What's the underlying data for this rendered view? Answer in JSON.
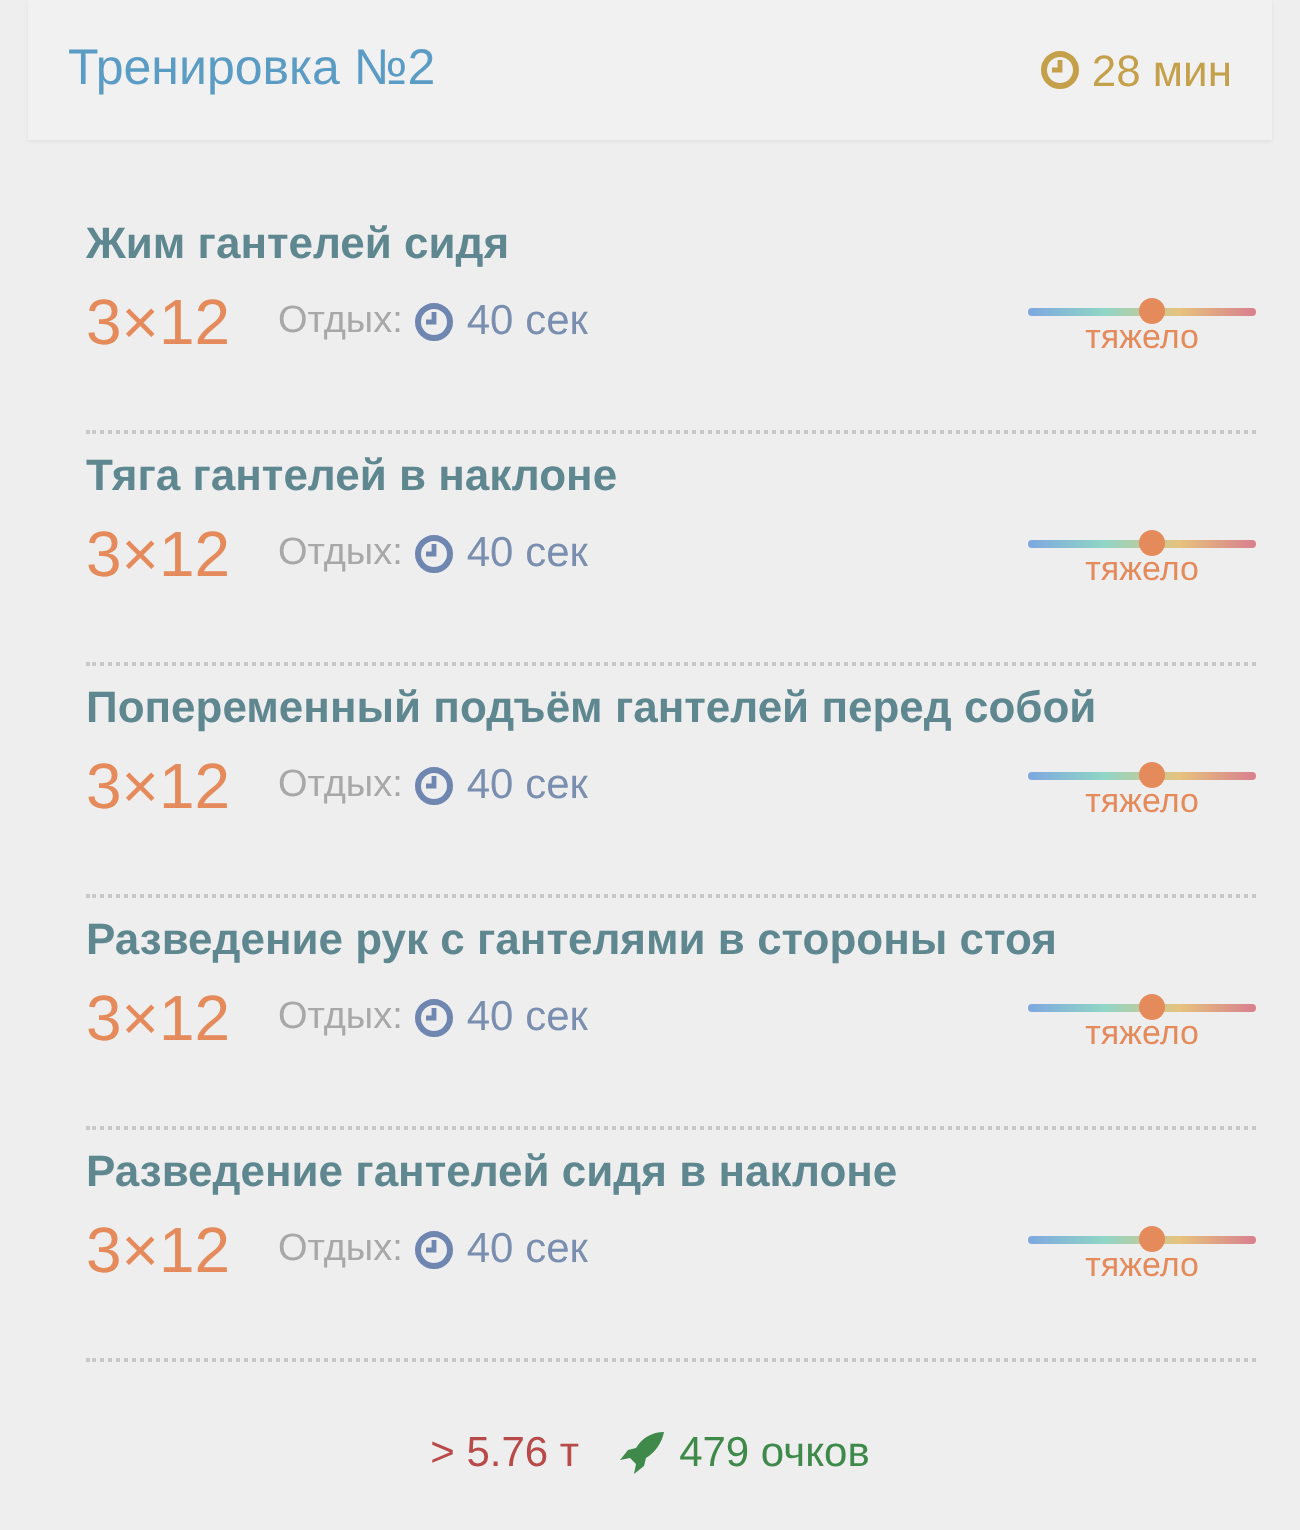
{
  "header": {
    "title": "Тренировка №2",
    "duration": "28 мин"
  },
  "exercises": [
    {
      "name": "Жим гантелей сидя",
      "sets": "3×12",
      "rest_label": "Отдых:",
      "rest": "40 сек",
      "level": 0.54,
      "difficulty": "тяжело"
    },
    {
      "name": "Тяга гантелей в наклоне",
      "sets": "3×12",
      "rest_label": "Отдых:",
      "rest": "40 сек",
      "level": 0.54,
      "difficulty": "тяжело"
    },
    {
      "name": "Попеременный подъём гантелей перед собой",
      "sets": "3×12",
      "rest_label": "Отдых:",
      "rest": "40 сек",
      "level": 0.54,
      "difficulty": "тяжело"
    },
    {
      "name": "Разведение рук с гантелями в стороны стоя",
      "sets": "3×12",
      "rest_label": "Отдых:",
      "rest": "40 сек",
      "level": 0.54,
      "difficulty": "тяжело"
    },
    {
      "name": "Разведение гантелей сидя в наклоне",
      "sets": "3×12",
      "rest_label": "Отдых:",
      "rest": "40 сек",
      "level": 0.54,
      "difficulty": "тяжело"
    }
  ],
  "summary": {
    "weight": "> 5.76 т",
    "points": "479 очков"
  }
}
